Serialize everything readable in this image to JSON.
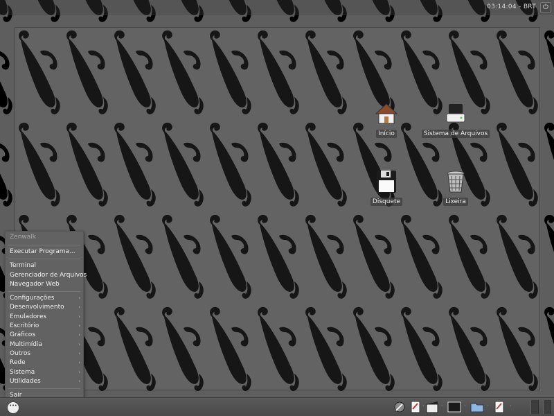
{
  "top_bar": {
    "clock": "03:14:04 - BRT"
  },
  "desktop_icons": [
    {
      "label": "Início",
      "icon": "home-icon"
    },
    {
      "label": "Sistema de Arquivos",
      "icon": "filesystem-drive-icon"
    },
    {
      "label": "Disquete",
      "icon": "floppy-disk-icon"
    },
    {
      "label": "Lixeira",
      "icon": "trash-icon"
    }
  ],
  "menu": {
    "title": "Zenwalk",
    "run": "Executar Programa...",
    "apps": [
      "Terminal",
      "Gerenciador de Arquivos",
      "Navegador Web"
    ],
    "categories": [
      "Configurações",
      "Desenvolvimento",
      "Emuladores",
      "Escritório",
      "Gráficos",
      "Multimídia",
      "Outros",
      "Rede",
      "Sistema",
      "Utilidades"
    ],
    "quit": "Sair"
  },
  "panel": {
    "launchers": [
      "settings-wrench-icon",
      "text-editor-icon",
      "video-player-icon",
      "terminal-icon",
      "folder-icon",
      "document-editor-icon"
    ]
  }
}
